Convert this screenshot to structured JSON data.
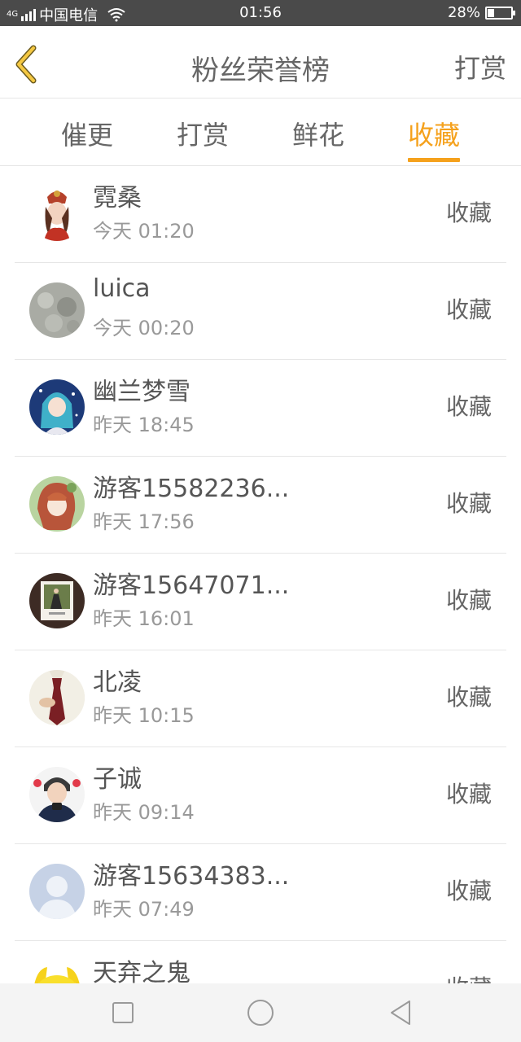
{
  "status": {
    "signal": "4G",
    "carrier": "中国电信",
    "time": "01:56",
    "battery": "28%",
    "battery_level": 0.28
  },
  "header": {
    "title": "粉丝荣誉榜",
    "action": "打赏"
  },
  "tabs": [
    {
      "label": "催更",
      "active": false
    },
    {
      "label": "打赏",
      "active": false
    },
    {
      "label": "鲜花",
      "active": false
    },
    {
      "label": "收藏",
      "active": true
    }
  ],
  "accent_color": "#f5a11c",
  "rows": [
    {
      "name": "霓桑",
      "time": "今天 01:20",
      "action": "收藏",
      "avatar": "costume-girl-avatar"
    },
    {
      "name": "luica",
      "time": "今天 00:20",
      "action": "收藏",
      "avatar": "gray-texture-avatar"
    },
    {
      "name": "幽兰梦雪",
      "time": "昨天 18:45",
      "action": "收藏",
      "avatar": "anime-blue-avatar"
    },
    {
      "name": "游客15582236...",
      "time": "昨天 17:56",
      "action": "收藏",
      "avatar": "anime-green-avatar"
    },
    {
      "name": "游客15647071...",
      "time": "昨天 16:01",
      "action": "收藏",
      "avatar": "photo-frame-avatar"
    },
    {
      "name": "北凌",
      "time": "昨天 10:15",
      "action": "收藏",
      "avatar": "shirt-tie-avatar"
    },
    {
      "name": "子诚",
      "time": "昨天 09:14",
      "action": "收藏",
      "avatar": "boy-photo-avatar"
    },
    {
      "name": "游客15634383...",
      "time": "昨天 07:49",
      "action": "收藏",
      "avatar": "default-user-avatar"
    },
    {
      "name": "天弃之鬼",
      "time": "",
      "action": "收藏",
      "avatar": "yellow-cartoon-avatar"
    }
  ]
}
